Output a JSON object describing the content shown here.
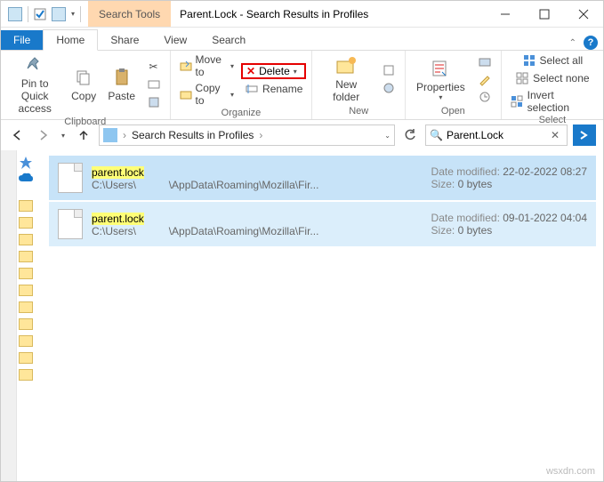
{
  "window": {
    "context_tab": "Search Tools",
    "title": "Parent.Lock - Search Results in Profiles"
  },
  "tabs": {
    "file": "File",
    "home": "Home",
    "share": "Share",
    "view": "View",
    "search": "Search"
  },
  "ribbon": {
    "clipboard": {
      "pin": "Pin to Quick access",
      "copy": "Copy",
      "paste": "Paste",
      "label": "Clipboard"
    },
    "organize": {
      "moveto": "Move to",
      "copyto": "Copy to",
      "delete": "Delete",
      "rename": "Rename",
      "label": "Organize"
    },
    "new": {
      "newfolder": "New folder",
      "label": "New"
    },
    "open": {
      "properties": "Properties",
      "label": "Open"
    },
    "select": {
      "all": "Select all",
      "none": "Select none",
      "invert": "Invert selection",
      "label": "Select"
    }
  },
  "nav": {
    "crumb1": "Search Results in Profiles",
    "search_value": "Parent.Lock"
  },
  "results": [
    {
      "name": "parent.lock",
      "path_prefix": "C:\\Users\\",
      "path_suffix": "\\AppData\\Roaming\\Mozilla\\Fir...",
      "date_label": "Date modified:",
      "date_value": "22-02-2022 08:27",
      "size_label": "Size:",
      "size_value": "0 bytes"
    },
    {
      "name": "parent.lock",
      "path_prefix": "C:\\Users\\",
      "path_suffix": "\\AppData\\Roaming\\Mozilla\\Fir...",
      "date_label": "Date modified:",
      "date_value": "09-01-2022 04:04",
      "size_label": "Size:",
      "size_value": "0 bytes"
    }
  ],
  "watermark": "wsxdn.com"
}
